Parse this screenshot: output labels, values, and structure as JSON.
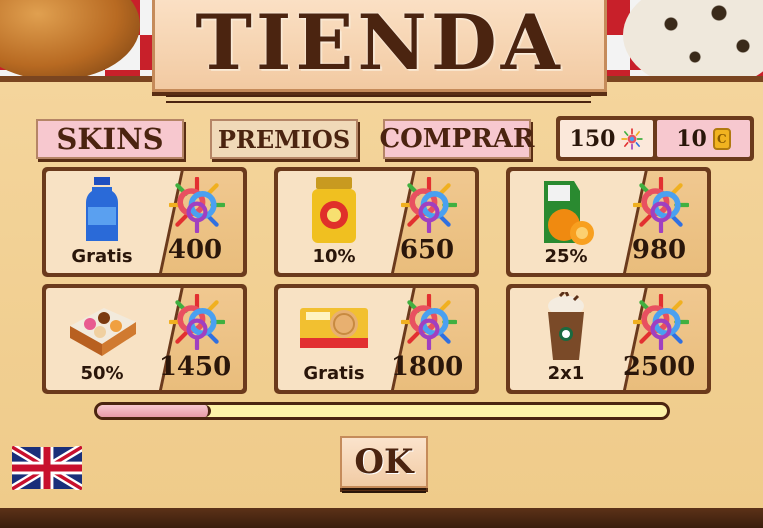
{
  "title": "TIENDA",
  "tabs": [
    {
      "label": "SKINS"
    },
    {
      "label": "PREMIOS"
    },
    {
      "label": "COMPRAR"
    }
  ],
  "currency": {
    "candies": "150",
    "coins": "10",
    "coin_symbol": "C"
  },
  "rewards": [
    {
      "item": "water-bottle",
      "label": "Gratis",
      "price": "400"
    },
    {
      "item": "cocoa-jar",
      "label": "10%",
      "price": "650"
    },
    {
      "item": "orange-juice",
      "label": "25%",
      "price": "980"
    },
    {
      "item": "donut-box",
      "label": "50%",
      "price": "1450"
    },
    {
      "item": "cookie-pack",
      "label": "Gratis",
      "price": "1800"
    },
    {
      "item": "frappuccino",
      "label": "2x1",
      "price": "2500"
    }
  ],
  "progress": {
    "fraction": 0.2
  },
  "ok_label": "OK",
  "language_flag": "uk-flag-icon",
  "colors": {
    "wood": "#6b3a1c",
    "panel": "#f4d59c",
    "pink_tab": "#f7c8cf",
    "text_dark": "#4b2410"
  }
}
